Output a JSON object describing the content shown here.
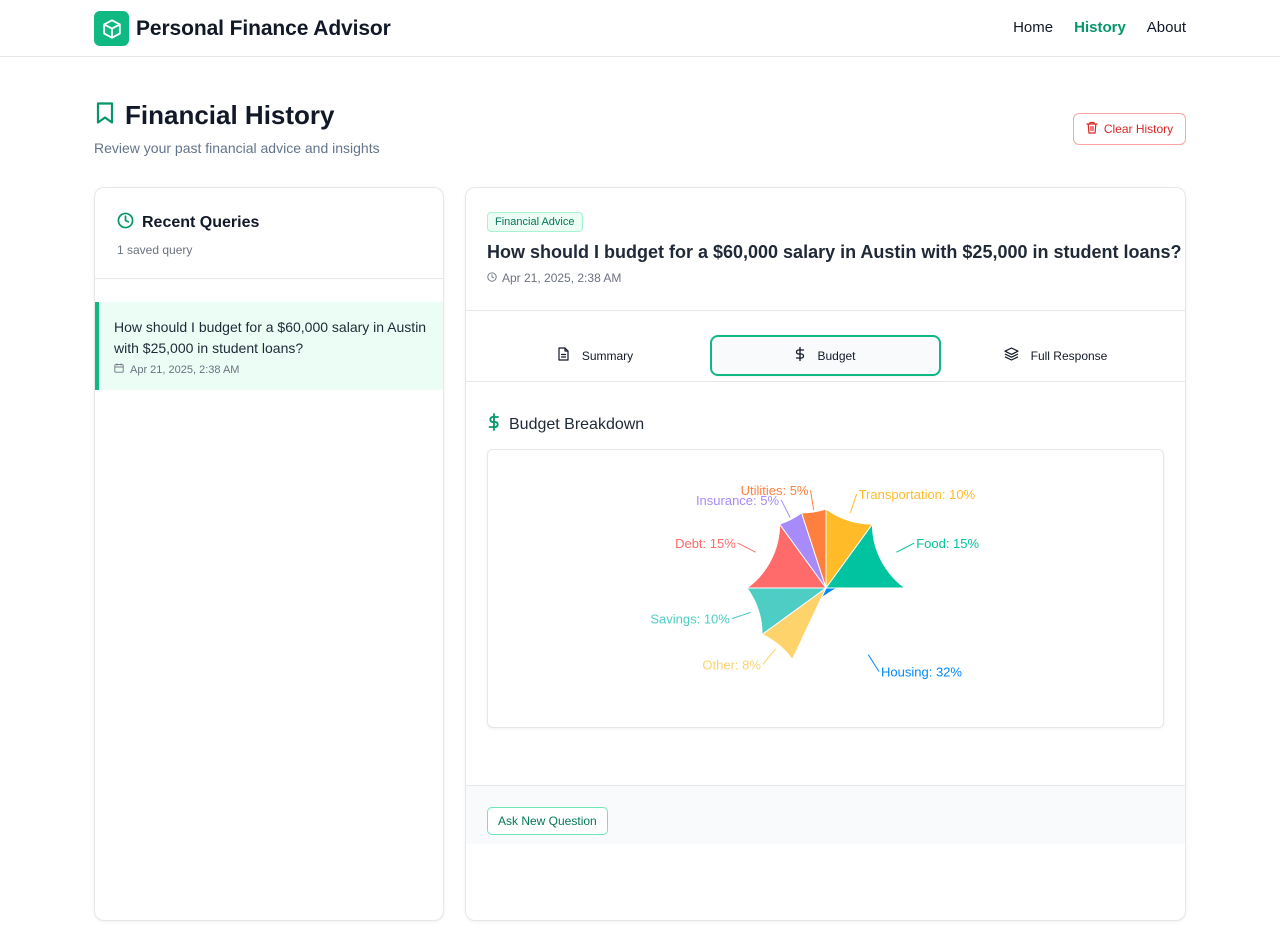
{
  "header": {
    "app_title": "Personal Finance Advisor",
    "nav": [
      {
        "label": "Home",
        "active": false
      },
      {
        "label": "History",
        "active": true
      },
      {
        "label": "About",
        "active": false
      }
    ],
    "accent_color": "#10b981"
  },
  "page": {
    "title": "Financial History",
    "subtitle": "Review your past financial advice and insights",
    "clear_button": "Clear History"
  },
  "sidebar": {
    "title": "Recent Queries",
    "count_text": "1 saved query",
    "items": [
      {
        "text": "How should I budget for a $60,000 salary in Austin with $25,000 in student loans?",
        "date": "Apr 21, 2025, 2:38 AM",
        "selected": true
      }
    ]
  },
  "detail": {
    "tag": "Financial Advice",
    "question": "How should I budget for a $60,000 salary in Austin with $25,000 in student loans?",
    "date": "Apr 21, 2025, 2:38 AM",
    "tabs": [
      {
        "label": "Summary",
        "icon": "document-icon",
        "active": false
      },
      {
        "label": "Budget",
        "icon": "dollar-icon",
        "active": true
      },
      {
        "label": "Full Response",
        "icon": "layers-icon",
        "active": false
      }
    ],
    "section_title": "Budget Breakdown",
    "ask_button": "Ask New Question"
  },
  "chart_data": {
    "type": "pie",
    "title": "",
    "slices": [
      {
        "name": "Housing",
        "value": 32,
        "label": "Housing: 32%",
        "color": "#0088fe"
      },
      {
        "name": "Other",
        "value": 8,
        "label": "Other: 8%",
        "color": "#ffd36b"
      },
      {
        "name": "Savings",
        "value": 10,
        "label": "Savings: 10%",
        "color": "#4ecdc4"
      },
      {
        "name": "Debt",
        "value": 15,
        "label": "Debt: 15%",
        "color": "#ff6b6b"
      },
      {
        "name": "Insurance",
        "value": 5,
        "label": "Insurance: 5%",
        "color": "#a78bfa"
      },
      {
        "name": "Utilities",
        "value": 5,
        "label": "Utilities: 5%",
        "color": "#ff7f3f"
      },
      {
        "name": "Transportation",
        "value": 10,
        "label": "Transportation: 10%",
        "color": "#ffbb28"
      },
      {
        "name": "Food",
        "value": 15,
        "label": "Food: 15%",
        "color": "#00c49f"
      }
    ]
  }
}
